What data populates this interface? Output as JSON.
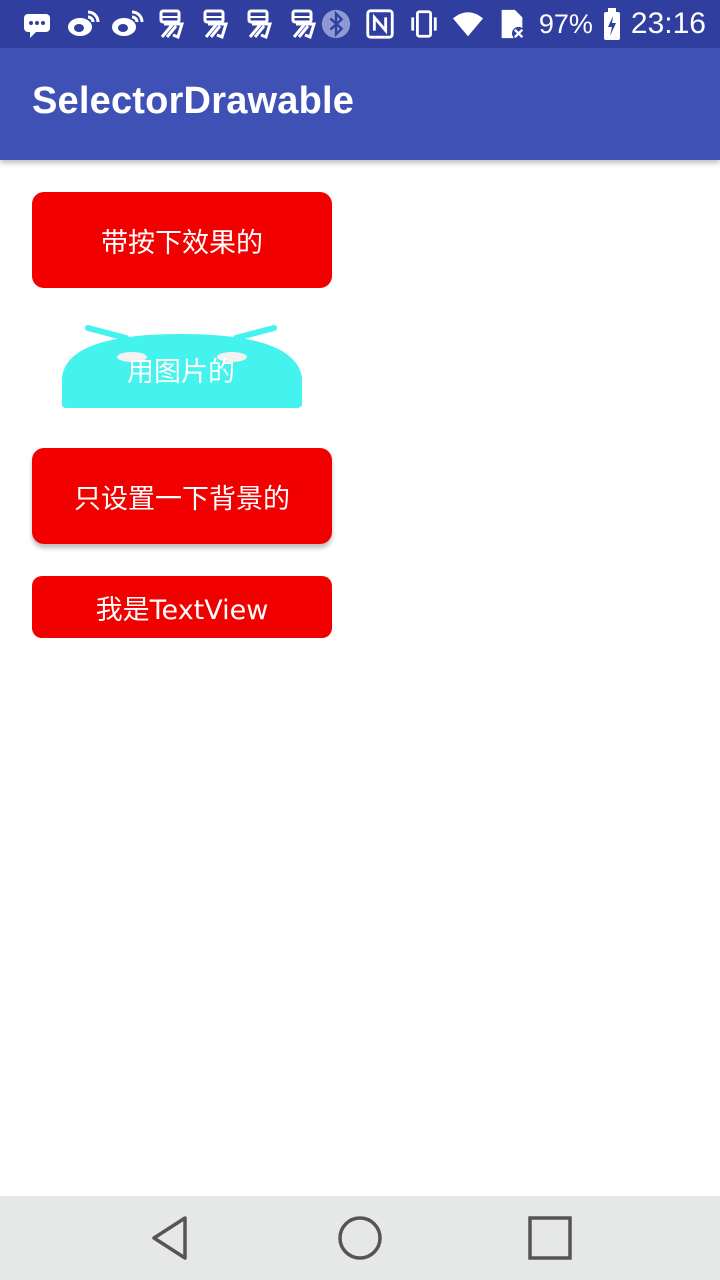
{
  "status_bar": {
    "icons_left": [
      "message-icon",
      "weibo-icon",
      "weibo-icon",
      "yi-icon",
      "yi-icon",
      "yi-icon",
      "yi-icon"
    ],
    "icons_right": [
      "bluetooth-icon",
      "nfc-icon",
      "vibrate-icon",
      "wifi-icon",
      "sim-icon"
    ],
    "battery_percent": "97%",
    "time": "23:16"
  },
  "app_bar": {
    "title": "SelectorDrawable"
  },
  "content": {
    "button_pressed_effect": "带按下效果的",
    "button_image": "用图片的",
    "button_background_only": "只设置一下背景的",
    "textview": "我是TextView"
  },
  "colors": {
    "status_bar": "#303f9f",
    "app_bar": "#3f51b5",
    "button_red": "#f20000",
    "image_cyan": "#44f2ee",
    "nav_bar": "#e6e8e8"
  },
  "nav_bar": {
    "icons": [
      "back-icon",
      "home-icon",
      "recents-icon"
    ]
  }
}
